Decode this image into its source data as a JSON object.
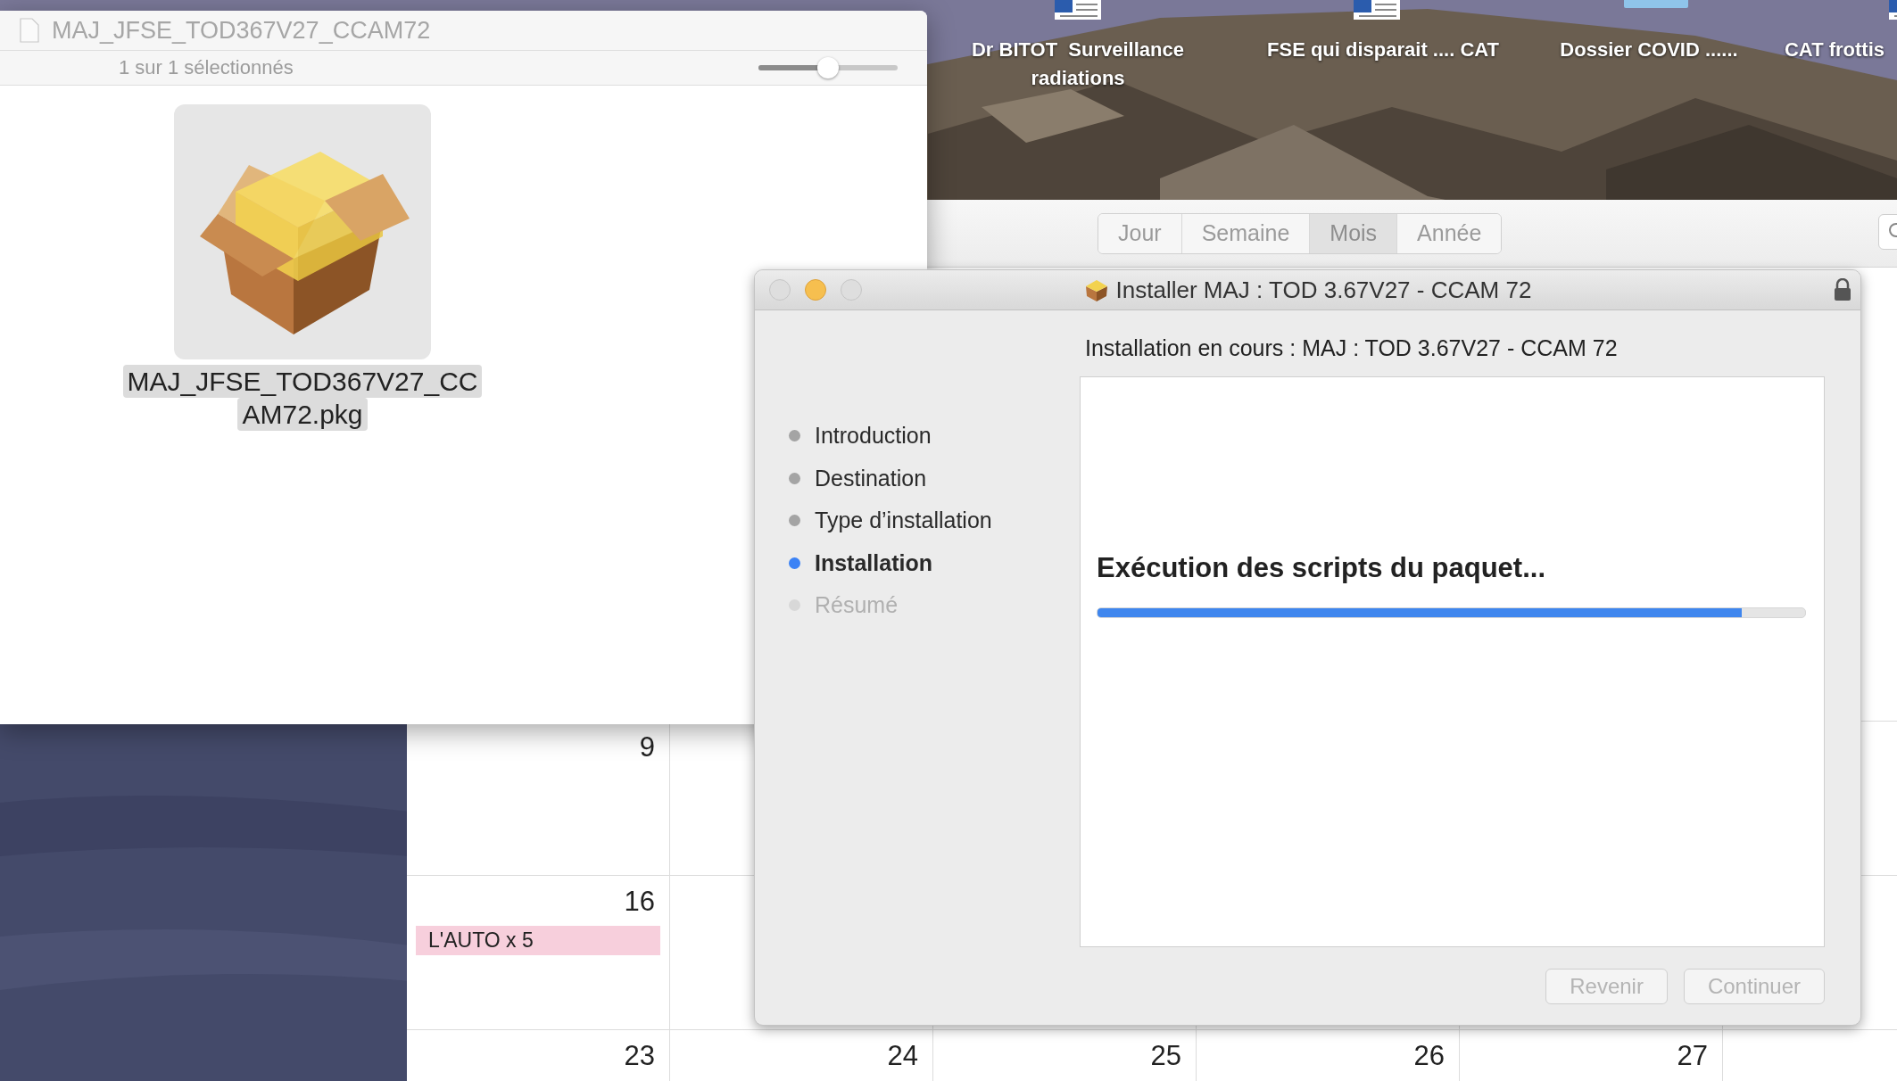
{
  "desktop": {
    "icons": [
      {
        "label": "Dr BITOT  Surveillance radiations",
        "kind": "document"
      },
      {
        "label": "FSE qui disparait .... CAT",
        "kind": "document"
      },
      {
        "label": "Dossier COVID ......",
        "kind": "folder"
      },
      {
        "label": "CAT frottis",
        "kind": "document"
      }
    ]
  },
  "preview_window": {
    "title": "MAJ_JFSE_TOD367V27_CCAM72",
    "status": "1 sur 1 sélectionnés",
    "zoom_slider": {
      "level": 0.5
    },
    "file": {
      "name_lines": [
        "MAJ_JFSE_TOD367V27_CC",
        "AM72.pkg"
      ],
      "selected": true
    }
  },
  "calendar": {
    "view_tabs": [
      {
        "label": "Jour",
        "selected": false
      },
      {
        "label": "Semaine",
        "selected": false
      },
      {
        "label": "Mois",
        "selected": true
      },
      {
        "label": "Année",
        "selected": false
      }
    ],
    "weeks": [
      {
        "cells": [
          {
            "day": "9"
          }
        ]
      },
      {
        "cells": [
          {
            "day": "16",
            "events": [
              "L'AUTO x 5"
            ]
          }
        ]
      },
      {
        "cells": [
          {
            "day": "23"
          },
          {
            "day": "24"
          },
          {
            "day": "25"
          },
          {
            "day": "26"
          },
          {
            "day": "27"
          }
        ]
      }
    ]
  },
  "installer": {
    "title": "Installer MAJ : TOD 3.67V27 - CCAM 72",
    "heading": "Installation en cours : MAJ : TOD 3.67V27 - CCAM 72",
    "steps": [
      {
        "label": "Introduction",
        "selected": false,
        "disabled": false
      },
      {
        "label": "Destination",
        "selected": false,
        "disabled": false
      },
      {
        "label": "Type d’installation",
        "selected": false,
        "disabled": false
      },
      {
        "label": "Installation",
        "selected": true,
        "disabled": false
      },
      {
        "label": "Résumé",
        "selected": false,
        "disabled": true
      }
    ],
    "status": "Exécution des scripts du paquet...",
    "progress": {
      "level": 0.91
    },
    "buttons": [
      {
        "label": "Revenir",
        "disabled": true
      },
      {
        "label": "Continuer",
        "disabled": true
      }
    ]
  }
}
